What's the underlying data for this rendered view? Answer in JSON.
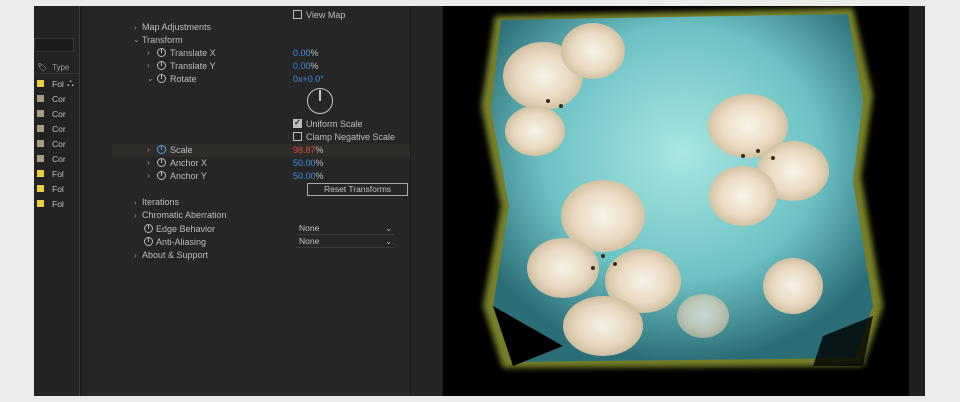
{
  "project_panel": {
    "header": {
      "tag_icon": "tag-icon",
      "type_label": "Type"
    },
    "rows": [
      {
        "name": "Fol",
        "color": "#e6cf3c",
        "has_org_icon": true
      },
      {
        "name": "Cor",
        "color": "#a79d82"
      },
      {
        "name": "Cor",
        "color": "#a79d82"
      },
      {
        "name": "Cor",
        "color": "#a79d82"
      },
      {
        "name": "Cor",
        "color": "#a79d82"
      },
      {
        "name": "Cor",
        "color": "#a79d82"
      },
      {
        "name": "Fol",
        "color": "#e6cf3c"
      },
      {
        "name": "Fol",
        "color": "#e6cf3c"
      },
      {
        "name": "Fol",
        "color": "#e6cf3c"
      }
    ]
  },
  "effect_controls": {
    "view_map": {
      "label": "View Map",
      "checked": false
    },
    "map_adjustments": "Map Adjustments",
    "transform": {
      "label": "Transform",
      "translate_x": {
        "label": "Translate X",
        "value": "0.00",
        "unit": "%"
      },
      "translate_y": {
        "label": "Translate Y",
        "value": "0.00",
        "unit": "%"
      },
      "rotate": {
        "label": "Rotate",
        "value": "0x+0.0°"
      },
      "uniform_scale": {
        "label": "Uniform Scale",
        "checked": true
      },
      "clamp_negative_scale": {
        "label": "Clamp Negative Scale",
        "checked": false
      },
      "scale": {
        "label": "Scale",
        "value": "98.87",
        "unit": "%"
      },
      "anchor_x": {
        "label": "Anchor X",
        "value": "50.00",
        "unit": "%"
      },
      "anchor_y": {
        "label": "Anchor Y",
        "value": "50.00",
        "unit": "%"
      },
      "reset_button": "Reset Transforms"
    },
    "iterations": "Iterations",
    "chromatic_aberration": "Chromatic Aberration",
    "edge_behavior": {
      "label": "Edge Behavior",
      "value": "None"
    },
    "anti_aliasing": {
      "label": "Anti-Aliasing",
      "value": "None"
    },
    "about_support": "About & Support"
  },
  "colors": {
    "accent_blue": "#3d8fe0",
    "scale_red": "#d84a3a",
    "panel_bg": "#262626"
  }
}
